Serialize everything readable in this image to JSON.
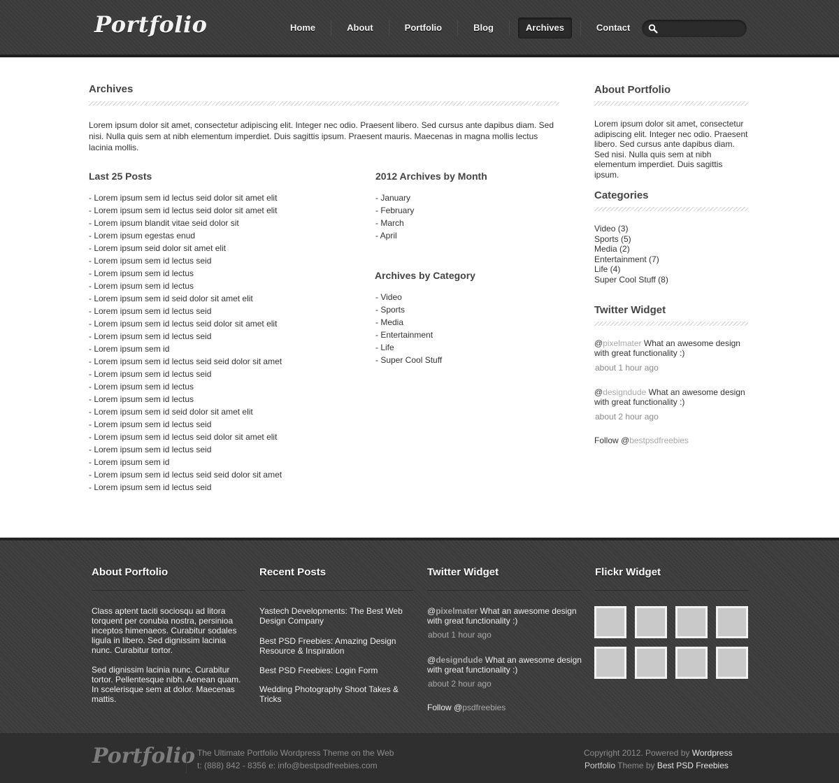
{
  "header": {
    "logo": "Portfolio",
    "nav": [
      {
        "label": "Home"
      },
      {
        "label": "About"
      },
      {
        "label": "Portfolio"
      },
      {
        "label": "Blog"
      },
      {
        "label": "Archives",
        "active": true
      },
      {
        "label": "Contact"
      }
    ],
    "search_placeholder": ""
  },
  "main": {
    "title": "Archives",
    "intro": "Lorem ipsum dolor sit amet, consectetur adipiscing elit. Integer nec odio. Praesent libero. Sed cursus ante dapibus diam. Sed nisi. Nulla quis sem at nibh elementum imperdiet. Duis sagittis ipsum. Praesent mauris. Maecenas in magna mollis lectus lacinia mollis.",
    "last_posts_title": "Last 25 Posts",
    "last_posts": [
      "- Lorem ipsum sem id lectus seid dolor sit amet elit",
      "- Lorem ipsum sem id lectus seid dolor sit amet elit",
      "- Lorem ipsum blandit vitae seid dolor sit",
      "- Lorem ipsum egestas enud",
      "- Lorem ipsum seid dolor sit amet elit",
      "- Lorem ipsum sem id lectus seid",
      "- Lorem ipsum sem id lectus",
      "- Lorem ipsum sem id lectus",
      "- Lorem ipsum sem id seid dolor sit amet elit",
      "- Lorem ipsum sem id lectus seid",
      "- Lorem ipsum sem id lectus seid dolor sit amet elit",
      "- Lorem ipsum sem id lectus seid",
      "- Lorem ipsum sem id",
      "- Lorem ipsum sem id lectus seid seid dolor sit amet",
      "- Lorem ipsum sem id lectus seid",
      "- Lorem ipsum sem id lectus",
      "- Lorem ipsum sem id lectus",
      "- Lorem ipsum sem id seid dolor sit amet elit",
      "- Lorem ipsum sem id lectus seid",
      "- Lorem ipsum sem id lectus seid dolor sit amet elit",
      "- Lorem ipsum sem id lectus seid",
      "- Lorem ipsum sem id",
      "- Lorem ipsum sem id lectus seid seid dolor sit amet",
      "- Lorem ipsum sem id lectus seid"
    ],
    "by_month_title": "2012 Archives by Month",
    "by_month": [
      "- January",
      "- February",
      "- March",
      "- April"
    ],
    "by_category_title": "Archives by Category",
    "by_category": [
      "- Video",
      "- Sports",
      "- Media",
      "- Entertainment",
      "- Life",
      "- Super Cool Stuff"
    ]
  },
  "sidebar": {
    "about_title": "About Portfolio",
    "about_text": "Lorem ipsum dolor sit amet, consectetur adipiscing elit. Integer nec odio. Praesent libero. Sed cursus ante dapibus diam. Sed nisi. Nulla quis sem at nibh elementum imperdiet. Duis sagittis ipsum.",
    "categories_title": "Categories",
    "categories": [
      "Video (3)",
      "Sports (5)",
      "Media (2)",
      "Entertainment (7)",
      "Life (4)",
      "Super Cool Stuff (8)"
    ],
    "twitter_title": "Twitter Widget",
    "tweets": [
      {
        "at": "@",
        "handle": "pixelmater",
        "text": " What an awesome design with great functionality :)",
        "time": "about 1 hour ago"
      },
      {
        "at": "@",
        "handle": "designdude",
        "text": " What an awesome design with great functionality :)",
        "time": "about 2 hour ago"
      }
    ],
    "follow_prefix": "Follow @",
    "follow_handle": "bestpsdfreebies"
  },
  "footer": {
    "about_title": "About Porftolio",
    "about_p1": "Class aptent taciti sociosqu ad litora torquent per conubia nostra, persinioa inceptos himenaeos. Curabitur sodales ligula in libero. Sed dignissim lacinia nunc. Curabitur tortor.",
    "about_p2": "Sed dignissim lacinia nunc. Curabitur tortor. Pellentesque nibh. Aenean quam. In scelerisque sem at dolor. Maecenas mattis.",
    "recent_title": "Recent Posts",
    "recent": [
      "Yastech Developments: The Best Web Design Company",
      "Best PSD Freebies: Amazing Design Resource & Inspiration",
      "Best PSD Freebies: Login Form",
      "Wedding Photography Shoot Takes & Tricks"
    ],
    "twitter_title": "Twitter Widget",
    "tweets": [
      {
        "at": "@",
        "handle": "pixelmater",
        "text": " What an awesome design with great functionality :)",
        "time": "about 1 hour ago"
      },
      {
        "at": "@",
        "handle": "designdude",
        "text": " What an awesome design with great functionality :)",
        "time": "about 2 hour ago"
      }
    ],
    "follow_prefix": "Follow @",
    "follow_handle": "psdfreebies",
    "flickr_title": "Flickr Widget"
  },
  "bottom": {
    "logo": "Portfolio",
    "tagline": "The Ultimate Portfolio  Wordpress Theme on the Web",
    "contact": "t: (888) 842 - 8356  e: info@bestpsdfreebies.com",
    "copyright_prefix": "Copyright 2012. Powered by ",
    "copyright_link": "Wordpress",
    "theme_name": "Portfolio",
    "theme_by": " Theme by ",
    "theme_author": "Best PSD Freebies"
  },
  "colors": {
    "header_bg": "#3b3b3b",
    "footer_bg": "#3c3c3c",
    "bottom_bg": "#2f2f2f",
    "handle_grey": "#a8a8a8"
  },
  "icons": {
    "search": "search-icon"
  }
}
